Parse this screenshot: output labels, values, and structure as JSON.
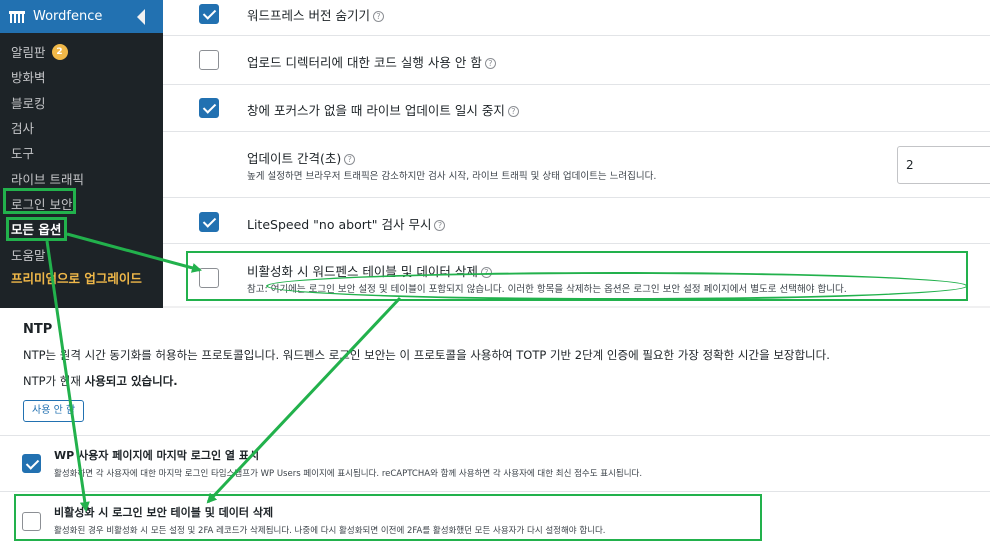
{
  "sidebar": {
    "brand": "Wordfence",
    "items": [
      {
        "label": "알림판",
        "badge": "2"
      },
      {
        "label": "방화벽"
      },
      {
        "label": "블로킹"
      },
      {
        "label": "검사"
      },
      {
        "label": "도구"
      },
      {
        "label": "라이브 트래픽"
      },
      {
        "label": "로그인 보안"
      },
      {
        "label": "모든 옵션"
      },
      {
        "label": "도움말"
      },
      {
        "label": "프리미엄으로 업그레이드"
      }
    ]
  },
  "settings": {
    "hide_version": {
      "label": "워드프레스 버전 숨기기",
      "checked": true
    },
    "upload_exec": {
      "label": "업로드 디렉터리에 대한 코드 실행 사용 안 함",
      "checked": false
    },
    "pause_live": {
      "label": "창에 포커스가 없을 때 라이브 업데이트 일시 중지",
      "checked": true
    },
    "update_interval": {
      "label": "업데이트 간격(초)",
      "desc": "높게 설정하면 브라우저 트래픽은 감소하지만 검사 시작, 라이브 트래픽 및 상태 업데이트는 느려집니다.",
      "value": "2"
    },
    "litespeed": {
      "label": "LiteSpeed \"no abort\" 검사 무시",
      "checked": true
    },
    "delete_tables": {
      "label": "비활성화 시 워드펜스 테이블 및 데이터 삭제",
      "desc": "참고: 여기에는 로그인 보안 설정 및 테이블이 포함되지 않습니다. 이러한 항목을 삭제하는 옵션은 로그인 보안 설정 페이지에서 별도로 선택해야 합니다.",
      "checked": false
    }
  },
  "ntp": {
    "title": "NTP",
    "desc": "NTP는 원격 시간 동기화를 허용하는 프로토콜입니다. 워드펜스 로그인 보안는 이 프로토콜을 사용하여 TOTP 기반 2단계 인증에 필요한 가장 정확한 시간을 보장합니다.",
    "status_prefix": "NTP가 현재 ",
    "status_bold": "사용되고 있습니다.",
    "button": "사용 안 함"
  },
  "login_security": {
    "last_login": {
      "label": "WP 사용자 페이지에 마지막 로그인 열 표시",
      "desc": "활성화하면 각 사용자에 대한 마지막 로그인 타임스탬프가 WP Users 페이지에 표시됩니다. reCAPTCHA와 함께 사용하면 각 사용자에 대한 최신 점수도 표시됩니다.",
      "checked": true
    },
    "delete_on_deactivate": {
      "label": "비활성화 시 로그인 보안 테이블 및 데이터 삭제",
      "desc": "활성화된 경우 비활성화 시 모든 설정 및 2FA 레코드가 삭제됩니다. 나중에 다시 활성화되면 이전에 2FA를 활성화했던 모든 사용자가 다시 설정해야 합니다.",
      "checked": false
    }
  },
  "colors": {
    "annotation": "#22b14c",
    "primary": "#2271b1",
    "badge": "#f0b849"
  }
}
